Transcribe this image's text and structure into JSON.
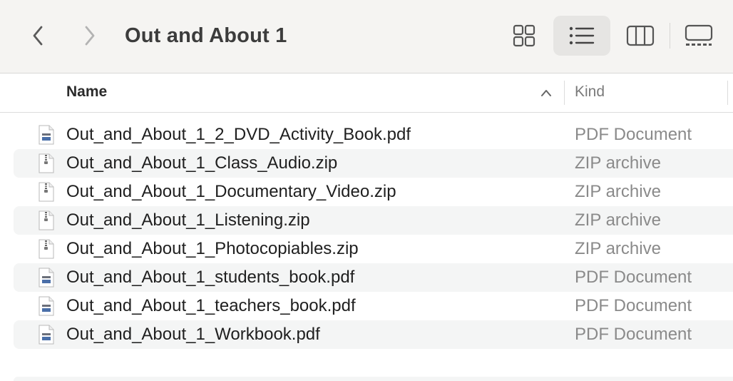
{
  "window": {
    "title": "Out and About 1"
  },
  "toolbar": {
    "back_icon": "chevron-left-icon",
    "forward_icon": "chevron-right-icon",
    "views": [
      {
        "name": "icon-view",
        "icon": "grid-icon",
        "active": false
      },
      {
        "name": "list-view",
        "icon": "list-icon",
        "active": true
      },
      {
        "name": "column-view",
        "icon": "columns-icon",
        "active": false
      },
      {
        "name": "gallery-view",
        "icon": "gallery-icon",
        "active": false
      }
    ]
  },
  "columns": {
    "name": "Name",
    "kind": "Kind",
    "sort": "ascending"
  },
  "files": [
    {
      "name": "Out_and_About_1_2_DVD_Activity_Book.pdf",
      "kind": "PDF Document",
      "icon": "pdf-file-icon"
    },
    {
      "name": "Out_and_About_1_Class_Audio.zip",
      "kind": "ZIP archive",
      "icon": "zip-file-icon"
    },
    {
      "name": "Out_and_About_1_Documentary_Video.zip",
      "kind": "ZIP archive",
      "icon": "zip-file-icon"
    },
    {
      "name": "Out_and_About_1_Listening.zip",
      "kind": "ZIP archive",
      "icon": "zip-file-icon"
    },
    {
      "name": "Out_and_About_1_Photocopiables.zip",
      "kind": "ZIP archive",
      "icon": "zip-file-icon"
    },
    {
      "name": "Out_and_About_1_students_book.pdf",
      "kind": "PDF Document",
      "icon": "pdf-file-icon"
    },
    {
      "name": "Out_and_About_1_teachers_book.pdf",
      "kind": "PDF Document",
      "icon": "pdf-file-icon"
    },
    {
      "name": "Out_and_About_1_Workbook.pdf",
      "kind": "PDF Document",
      "icon": "pdf-file-icon"
    }
  ],
  "colors": {
    "toolbar_bg": "#f5f4f2",
    "row_alt": "#f4f5f5",
    "kind_text": "#8a8a8a"
  }
}
